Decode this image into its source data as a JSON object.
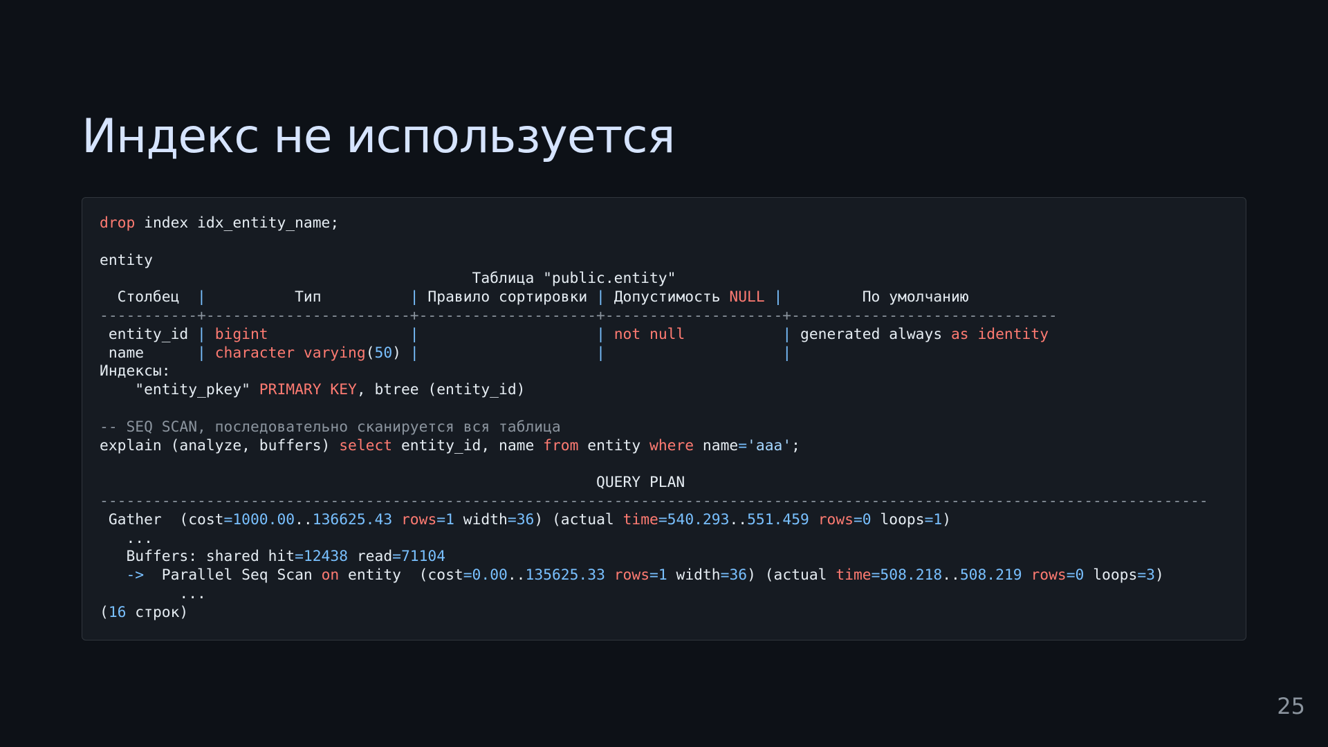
{
  "slide": {
    "title": "Индекс не используется",
    "page_number": "25"
  },
  "colors": {
    "background": "#0d1117",
    "panel": "#161b22",
    "title": "#d6e4ff",
    "text": "#e6edf3",
    "keyword": "#ff7b72",
    "number": "#79c0ff",
    "string": "#a5d6ff",
    "comment": "#8b949e"
  },
  "code": {
    "lines": [
      [
        {
          "t": "drop",
          "c": "kw"
        },
        {
          "t": " index idx_entity_name;"
        }
      ],
      [],
      [
        {
          "t": "entity"
        }
      ],
      [
        {
          "t": "                                          Таблица \"public.entity\""
        }
      ],
      [
        {
          "t": "  Столбец  "
        },
        {
          "t": "|",
          "c": "pipe"
        },
        {
          "t": "          Тип          "
        },
        {
          "t": "|",
          "c": "pipe"
        },
        {
          "t": " Правило сортировки "
        },
        {
          "t": "|",
          "c": "pipe"
        },
        {
          "t": " Допустимость "
        },
        {
          "t": "NULL",
          "c": "kw"
        },
        {
          "t": " "
        },
        {
          "t": "|",
          "c": "pipe"
        },
        {
          "t": "         По умолчанию"
        }
      ],
      [
        {
          "t": "-----------+-----------------------+--------------------+--------------------+------------------------------",
          "c": "dash"
        }
      ],
      [
        {
          "t": " entity_id "
        },
        {
          "t": "|",
          "c": "pipe"
        },
        {
          "t": " "
        },
        {
          "t": "bigint",
          "c": "kw"
        },
        {
          "t": "                "
        },
        {
          "t": "|",
          "c": "pipe"
        },
        {
          "t": "                    "
        },
        {
          "t": "|",
          "c": "pipe"
        },
        {
          "t": " "
        },
        {
          "t": "not null",
          "c": "kw"
        },
        {
          "t": "           "
        },
        {
          "t": "|",
          "c": "pipe"
        },
        {
          "t": " generated always "
        },
        {
          "t": "as",
          "c": "kw"
        },
        {
          "t": " "
        },
        {
          "t": "identity",
          "c": "kw"
        }
      ],
      [
        {
          "t": " name      "
        },
        {
          "t": "|",
          "c": "pipe"
        },
        {
          "t": " "
        },
        {
          "t": "character varying",
          "c": "kw"
        },
        {
          "t": "("
        },
        {
          "t": "50",
          "c": "num"
        },
        {
          "t": ") "
        },
        {
          "t": "|",
          "c": "pipe"
        },
        {
          "t": "                    "
        },
        {
          "t": "|",
          "c": "pipe"
        },
        {
          "t": "                    "
        },
        {
          "t": "|",
          "c": "pipe"
        }
      ],
      [
        {
          "t": "Индексы:"
        }
      ],
      [
        {
          "t": "    \"entity_pkey\" "
        },
        {
          "t": "PRIMARY KEY",
          "c": "kw"
        },
        {
          "t": ", btree (entity_id)"
        }
      ],
      [],
      [
        {
          "t": "-- SEQ SCAN, последовательно сканируется вся таблица",
          "c": "comment"
        }
      ],
      [
        {
          "t": "explain (analyze, buffers) "
        },
        {
          "t": "select",
          "c": "kw"
        },
        {
          "t": " entity_id, name "
        },
        {
          "t": "from",
          "c": "kw"
        },
        {
          "t": " entity "
        },
        {
          "t": "where",
          "c": "kw"
        },
        {
          "t": " name"
        },
        {
          "t": "=",
          "c": "num"
        },
        {
          "t": "'aaa'",
          "c": "str"
        },
        {
          "t": ";"
        }
      ],
      [],
      [
        {
          "t": "                                                        QUERY PLAN"
        }
      ],
      [
        {
          "t": "-----------------------------------------------------------------------------------------------------------------------------",
          "c": "dash"
        }
      ],
      [
        {
          "t": " Gather  (cost"
        },
        {
          "t": "=1000.00",
          "c": "num"
        },
        {
          "t": ".."
        },
        {
          "t": "136625.43",
          "c": "num"
        },
        {
          "t": " "
        },
        {
          "t": "rows",
          "c": "kw"
        },
        {
          "t": "=1",
          "c": "num"
        },
        {
          "t": " width"
        },
        {
          "t": "=36",
          "c": "num"
        },
        {
          "t": ") (actual "
        },
        {
          "t": "time",
          "c": "kw"
        },
        {
          "t": "=540.293",
          "c": "num"
        },
        {
          "t": ".."
        },
        {
          "t": "551.459",
          "c": "num"
        },
        {
          "t": " "
        },
        {
          "t": "rows",
          "c": "kw"
        },
        {
          "t": "=0",
          "c": "num"
        },
        {
          "t": " loops"
        },
        {
          "t": "=1",
          "c": "num"
        },
        {
          "t": ")"
        }
      ],
      [
        {
          "t": "   ..."
        }
      ],
      [
        {
          "t": "   Buffers: shared hit"
        },
        {
          "t": "=12438",
          "c": "num"
        },
        {
          "t": " read"
        },
        {
          "t": "=71104",
          "c": "num"
        }
      ],
      [
        {
          "t": "   ",
          "c": "num"
        },
        {
          "t": "->",
          "c": "num"
        },
        {
          "t": "  Parallel Seq Scan "
        },
        {
          "t": "on",
          "c": "kw"
        },
        {
          "t": " entity  (cost"
        },
        {
          "t": "=0.00",
          "c": "num"
        },
        {
          "t": ".."
        },
        {
          "t": "135625.33",
          "c": "num"
        },
        {
          "t": " "
        },
        {
          "t": "rows",
          "c": "kw"
        },
        {
          "t": "=1",
          "c": "num"
        },
        {
          "t": " width"
        },
        {
          "t": "=36",
          "c": "num"
        },
        {
          "t": ") (actual "
        },
        {
          "t": "time",
          "c": "kw"
        },
        {
          "t": "=508.218",
          "c": "num"
        },
        {
          "t": ".."
        },
        {
          "t": "508.219",
          "c": "num"
        },
        {
          "t": " "
        },
        {
          "t": "rows",
          "c": "kw"
        },
        {
          "t": "=0",
          "c": "num"
        },
        {
          "t": " loops"
        },
        {
          "t": "=3",
          "c": "num"
        },
        {
          "t": ")"
        }
      ],
      [
        {
          "t": "         ..."
        }
      ],
      [
        {
          "t": "("
        },
        {
          "t": "16",
          "c": "num"
        },
        {
          "t": " строк)"
        }
      ]
    ]
  }
}
